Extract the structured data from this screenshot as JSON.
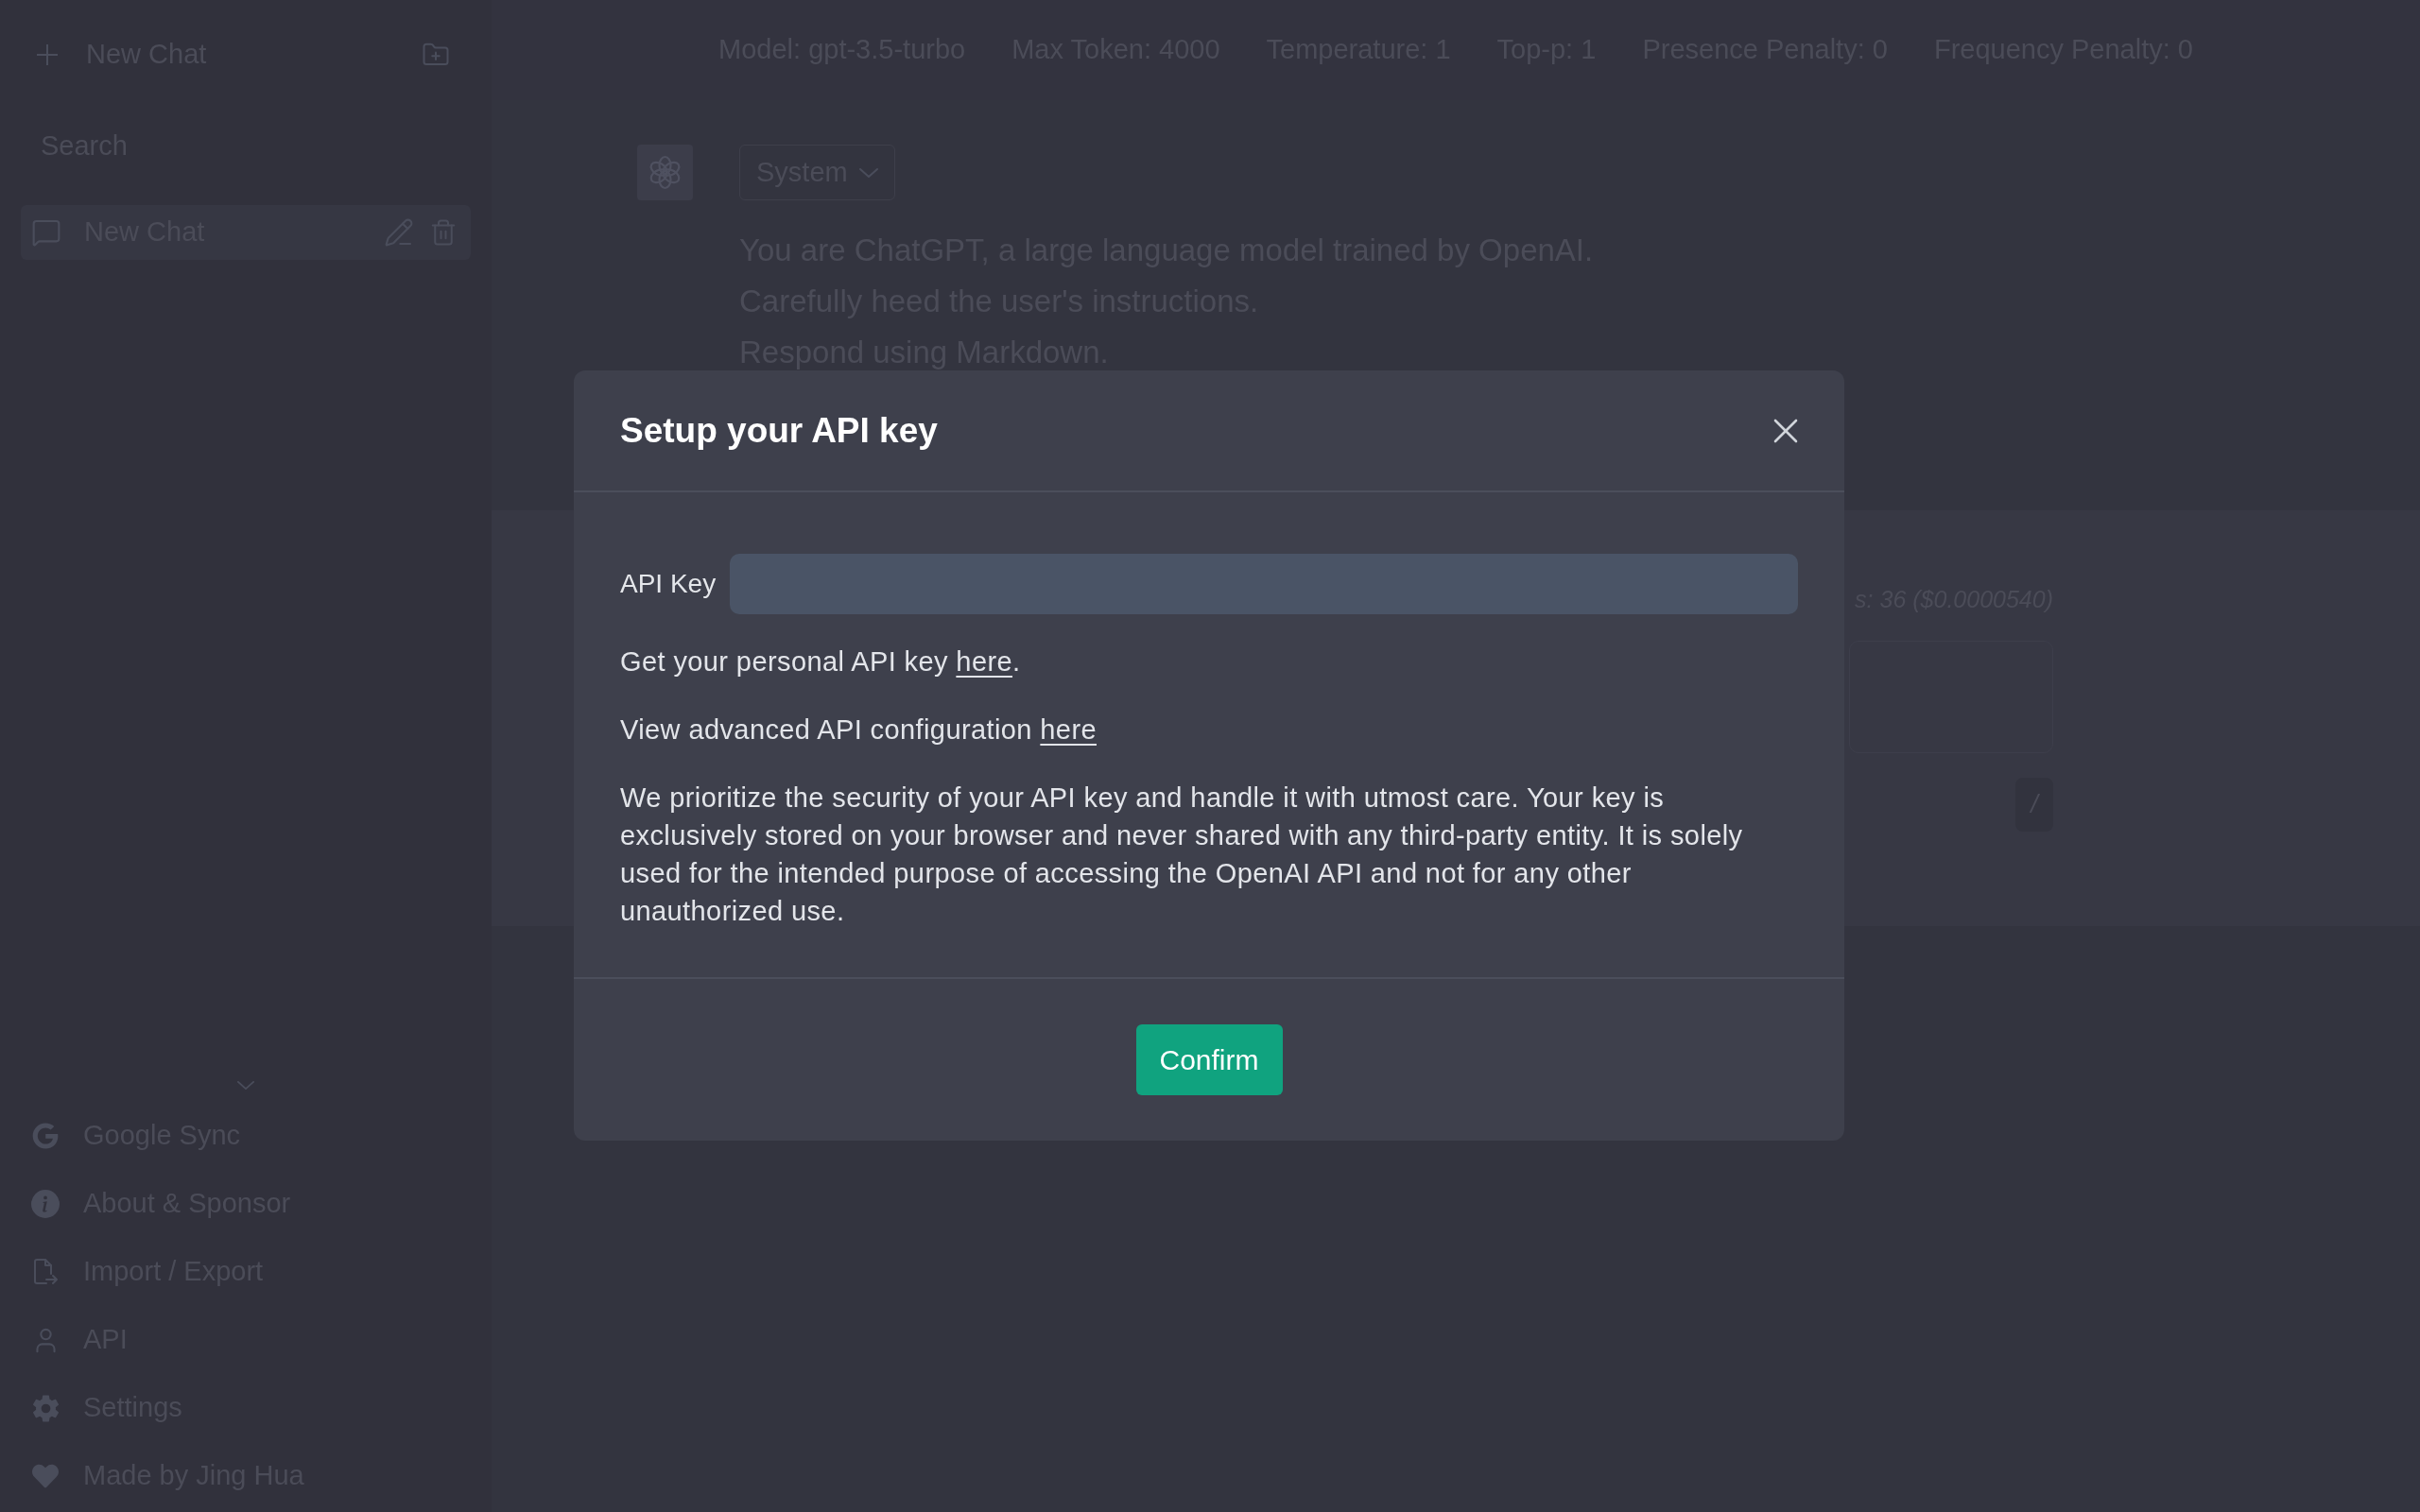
{
  "sidebar": {
    "new_chat_button": "New Chat",
    "search": {
      "placeholder": "Search"
    },
    "chats": [
      {
        "title": "New Chat",
        "selected": true
      }
    ],
    "menu": [
      "Google Sync",
      "About & Sponsor",
      "Import / Export",
      "API",
      "Settings",
      "Made by Jing Hua"
    ]
  },
  "top_bar": [
    "Model: gpt-3.5-turbo",
    "Max Token: 4000",
    "Temperature: 1",
    "Top-p: 1",
    "Presence Penalty: 0",
    "Frequency Penalty: 0"
  ],
  "messages": [
    {
      "kind": "system",
      "role": "System",
      "lines": [
        "You are ChatGPT, a large language model trained by OpenAI.",
        "Carefully heed the user's instructions.",
        "Respond using Markdown."
      ]
    },
    {
      "kind": "user",
      "token_info": "s: 36 ($0.0000540)",
      "command_key": "/"
    }
  ],
  "modal": {
    "title": "Setup your API key",
    "api_key_field": {
      "label": "API Key"
    },
    "paragraphs": [
      {
        "text": "Get your personal API key ",
        "link": "here",
        "after": "."
      },
      {
        "text": "View advanced API configuration ",
        "link": "here"
      },
      {
        "text": "We prioritize the security of your API key and handle it with utmost care. Your key is exclusively stored on your browser and never shared with any third-party entity. It is solely used for the intended purpose of accessing the OpenAI API and not for any other unauthorized use."
      }
    ],
    "confirm_button": "Confirm"
  }
}
